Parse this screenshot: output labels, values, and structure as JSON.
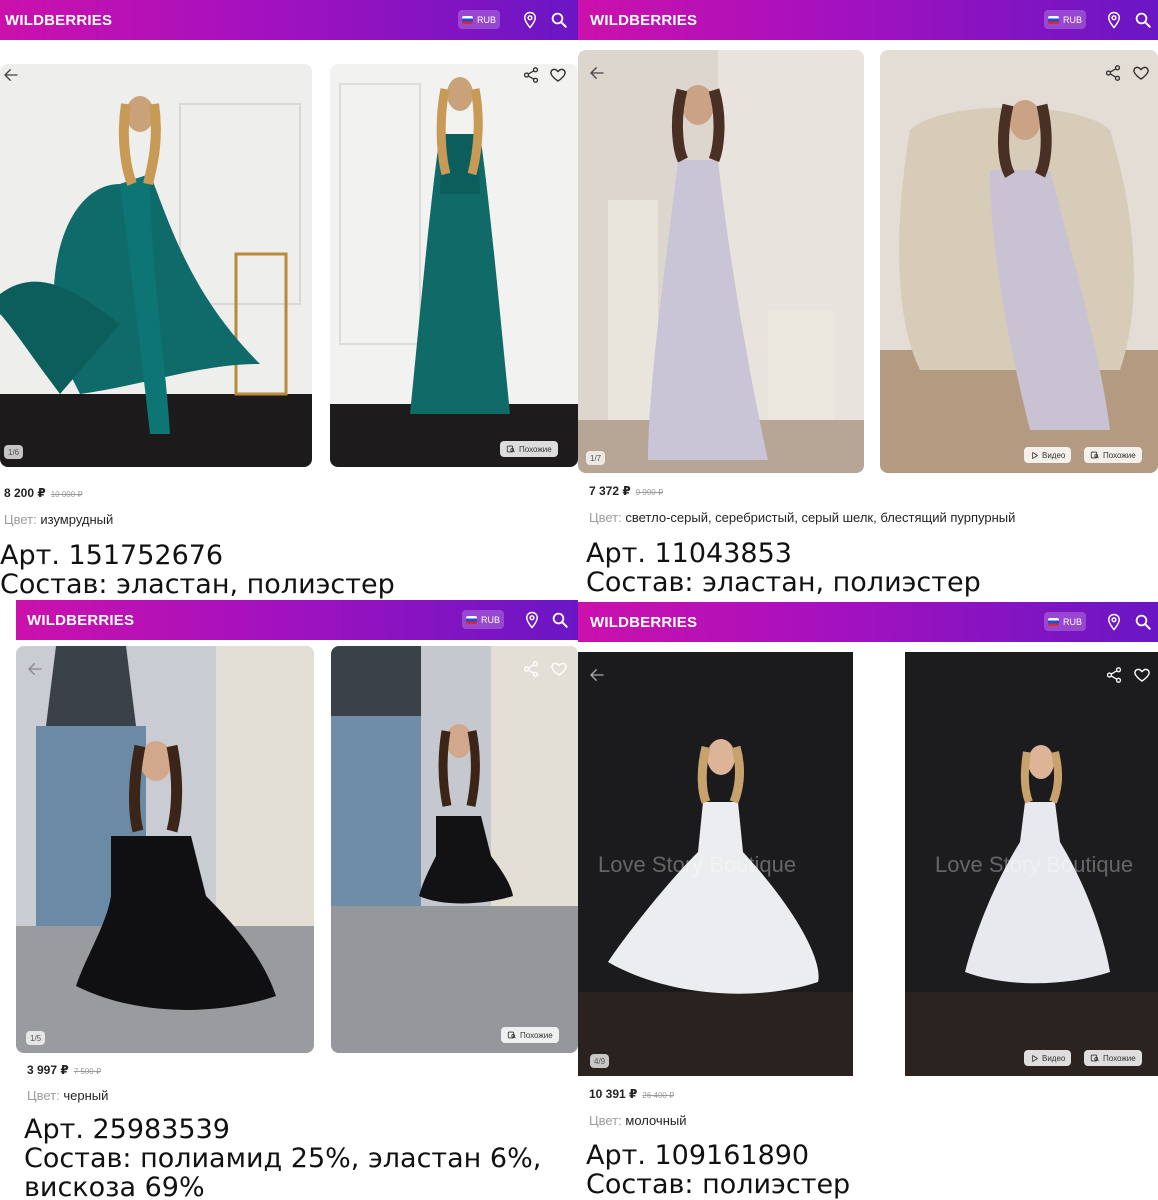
{
  "brand": "WILDBERRIES",
  "currency": "RUB",
  "colors": {
    "header_start": "#cb11ab",
    "header_end": "#6a16c4"
  },
  "panels": [
    {
      "price": "8 200 ₽",
      "old_price": "10 000 ₽",
      "color_label": "Цвет:",
      "color_value": "изумрудный",
      "photo_counter": "1/6",
      "similar_label": "Похожие",
      "article": "Арт. 151752676",
      "composition": "Состав: эластан, полиэстер"
    },
    {
      "price": "7 372 ₽",
      "old_price": "9 990 ₽",
      "color_label": "Цвет:",
      "color_value": "светло-серый, серебристый, серый шелк, блестящий пурпурный",
      "photo_counter": "1/7",
      "video_label": "Видео",
      "similar_label": "Похожие",
      "article": "Арт. 11043853",
      "composition": "Состав: эластан, полиэстер"
    },
    {
      "price": "3 997 ₽",
      "old_price": "7 500 ₽",
      "color_label": "Цвет:",
      "color_value": "черный",
      "photo_counter": "1/5",
      "similar_label": "Похожие",
      "article": "Арт. 25983539",
      "composition_line1": "Состав: полиамид 25%, эластан 6%,",
      "composition_line2": "вискоза 69%"
    },
    {
      "price": "10 391 ₽",
      "old_price": "26 400 ₽",
      "color_label": "Цвет:",
      "color_value": "молочный",
      "photo_counter": "4/9",
      "video_label": "Видео",
      "similar_label": "Похожие",
      "watermark": "Love Story Boutique",
      "article": "Арт. 109161890",
      "composition": "Состав: полиэстер"
    }
  ]
}
